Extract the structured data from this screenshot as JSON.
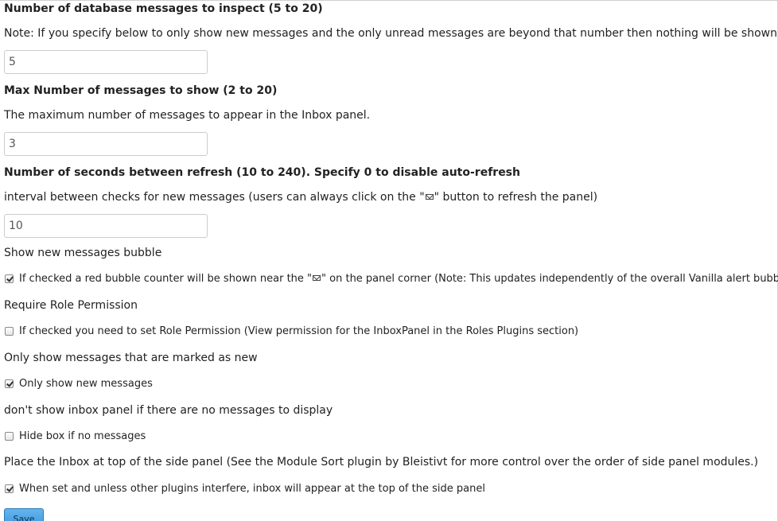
{
  "settings": {
    "db_messages": {
      "title": "Number of database messages to inspect (5 to 20)",
      "note": "Note: If you specify below to only show new messages and the only unread messages are beyond that number then nothing will be shown.",
      "value": "5"
    },
    "max_messages": {
      "title": "Max Number of messages to show (2 to 20)",
      "note": "The maximum number of messages to appear in the Inbox panel.",
      "value": "3"
    },
    "refresh": {
      "title": "Number of seconds between refresh (10 to 240). Specify 0 to disable auto-refresh",
      "note_before": "interval between checks for new messages (users can always click on the \"",
      "note_after": "\" button to refresh the panel)",
      "value": "10"
    },
    "bubble": {
      "label": "Show new messages bubble",
      "check_before": "If checked a red bubble counter will be shown near the \"",
      "check_after": "\" on the panel corner (Note: This updates independently of the overall Vanilla alert bubble)",
      "checked": true
    },
    "role": {
      "label": "Require Role Permission",
      "check_text": "If checked you need to set Role Permission (View permission for the InboxPanel in the Roles Plugins section)",
      "checked": false
    },
    "only_new": {
      "label": "Only show messages that are marked as new",
      "check_text": "Only show new messages",
      "checked": true
    },
    "hide_empty": {
      "label": "don't show inbox panel if there are no messages to display",
      "check_text": "Hide box if no messages",
      "checked": false
    },
    "top_panel": {
      "label": "Place the Inbox at top of the side panel (See the Module Sort plugin by Bleistivt for more control over the order of side panel modules.)",
      "check_text": "When set and unless other plugins interfere, inbox will appear at the top of the side panel",
      "checked": true
    }
  },
  "icons": {
    "mail": "envelope-icon"
  },
  "save_label": "Save"
}
